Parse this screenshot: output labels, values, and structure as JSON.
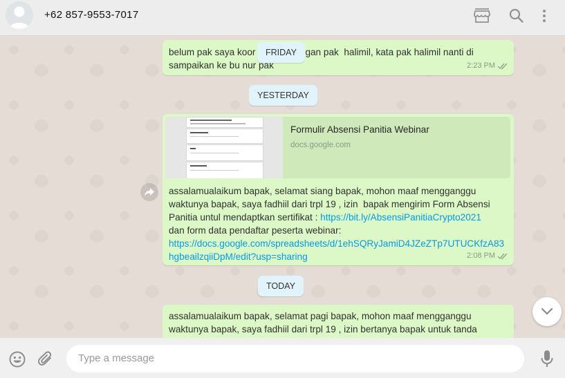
{
  "header": {
    "contact": "+62 857-9553-7017",
    "icons": [
      "avatar-icon",
      "store-icon",
      "search-icon",
      "menu-icon"
    ]
  },
  "dates": {
    "friday": "FRIDAY",
    "yesterday": "YESTERDAY",
    "today": "TODAY"
  },
  "messages": [
    {
      "text_before": "belum pak saya koor",
      "text_after": "gan pak  halimil, kata pak halimil nanti di sampaikan ke bu nur pak",
      "time": "2:23 PM"
    },
    {
      "preview_title": "Formulir Absensi Panitia Webinar",
      "preview_domain": "docs.google.com",
      "text_part1": "assalamualaikum bapak, selamat siang bapak, mohon maaf mengganggu waktunya bapak, saya fadhiil dari trpl 19 , izin  bapak mengirim Form Absensi Panitia untul mendaptkan sertifikat : ",
      "link1": "https://bit.ly/AbsensiPanitiaCrypto2021",
      "text_part2": "dan form data pendaftar peserta webinar:",
      "link2": "https://docs.google.com/spreadsheets/d/1ehSQRyJamiD4JZeZTp7UTUCKfzA83hgbeailzqiiDpM/edit?usp=sharing",
      "time": "2:08 PM"
    },
    {
      "text": "assalamualaikum bapak, selamat pagi bapak, mohon maaf mengganggu waktunya bapak, saya fadhiil dari trpl 19 , izin bertanya bapak untuk tanda"
    }
  ],
  "composer": {
    "placeholder": "Type a message",
    "icons": [
      "emoji-icon",
      "attach-icon",
      "mic-icon"
    ]
  },
  "colors": {
    "bubble_out": "#dcf8c6",
    "chat_bg": "#e5ddd5",
    "date_pill": "#e1f3fb",
    "link": "#039be5"
  }
}
